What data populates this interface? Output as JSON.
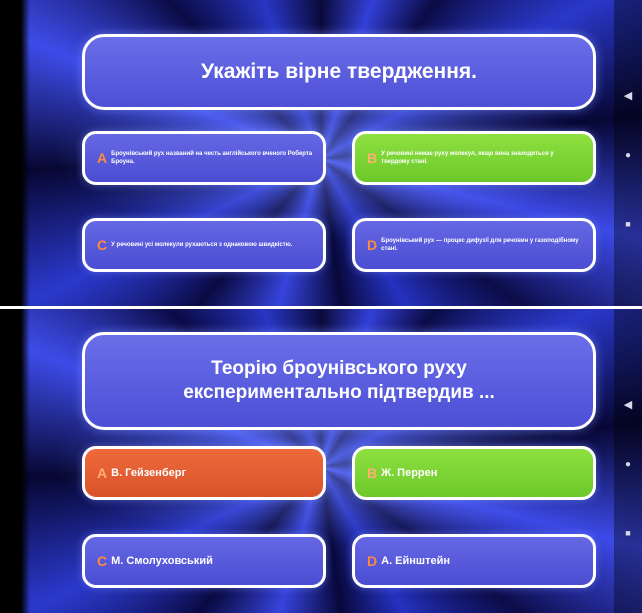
{
  "screens": [
    {
      "question": "Укажіть вірне твердження.",
      "answers": [
        {
          "letter": "A",
          "text": "Броунівський рух названий на честь англійського вченого Роберта Броуна.",
          "state": "normal"
        },
        {
          "letter": "B",
          "text": "У речовині немає руху молекул, якщо вона знаходиться у твердому стані.",
          "state": "correct"
        },
        {
          "letter": "C",
          "text": "У речовині усі молекули рухаються з однаковою швидкістю.",
          "state": "normal"
        },
        {
          "letter": "D",
          "text": "Броунівський рух — процес дифузії для речовин у газоподібному стані.",
          "state": "normal"
        }
      ]
    },
    {
      "question": "Теорію броунівського руху експериментально підтвердив ...",
      "answers": [
        {
          "letter": "A",
          "text": "В. Гейзенберг",
          "state": "wrong"
        },
        {
          "letter": "B",
          "text": "Ж. Перрен",
          "state": "correct"
        },
        {
          "letter": "C",
          "text": "М. Смолуховський",
          "state": "normal"
        },
        {
          "letter": "D",
          "text": "А. Ейнштейн",
          "state": "normal"
        }
      ]
    }
  ],
  "nav": {
    "back": "◀",
    "home": "●",
    "recent": "■"
  },
  "colors": {
    "correct": "#7ed632",
    "wrong": "#e0582e",
    "panel": "#5558dc",
    "letter": "#ff8a3c"
  }
}
